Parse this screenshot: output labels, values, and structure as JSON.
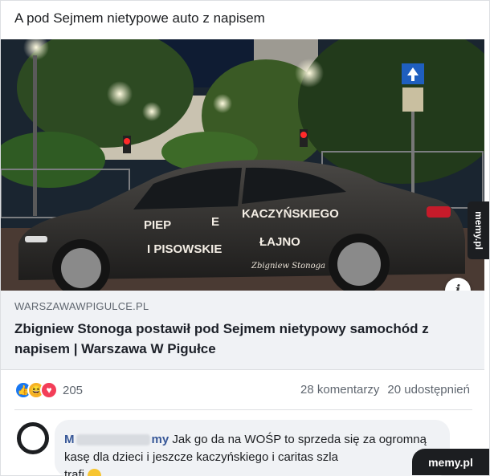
{
  "post": {
    "text": "A pod Sejmem nietypowe auto z napisem"
  },
  "photo": {
    "car_text": {
      "line1_left": "PIEP",
      "line1_mid": "E",
      "line1_right": "KACZYŃSKIEGO",
      "line2_left": "I PISOWSKIE",
      "line2_right": "ŁAJNO",
      "signature": "Zbigniew Stonoga"
    },
    "info_icon": "i"
  },
  "link": {
    "domain": "WARSZAWAWPIGULCE.PL",
    "title": "Zbigniew Stonoga postawił pod Sejmem nietypowy samochód z napisem | Warszawa W Pigułce"
  },
  "engagement": {
    "reaction_icons": [
      "like-icon",
      "haha-icon",
      "love-icon"
    ],
    "reaction_count": "205",
    "comments": "28 komentarzy",
    "shares": "20 udostępnień"
  },
  "comment": {
    "author_visible_start": "M",
    "author_visible_end": "my",
    "text": "Jak go da na WOŚP to sprzeda się za ogromną kasę dla dzieci i jeszcze kaczyńskiego i caritas szla",
    "text_end": "trafi"
  },
  "watermark": {
    "side": "memy.pl",
    "corner": "memy.pl"
  }
}
